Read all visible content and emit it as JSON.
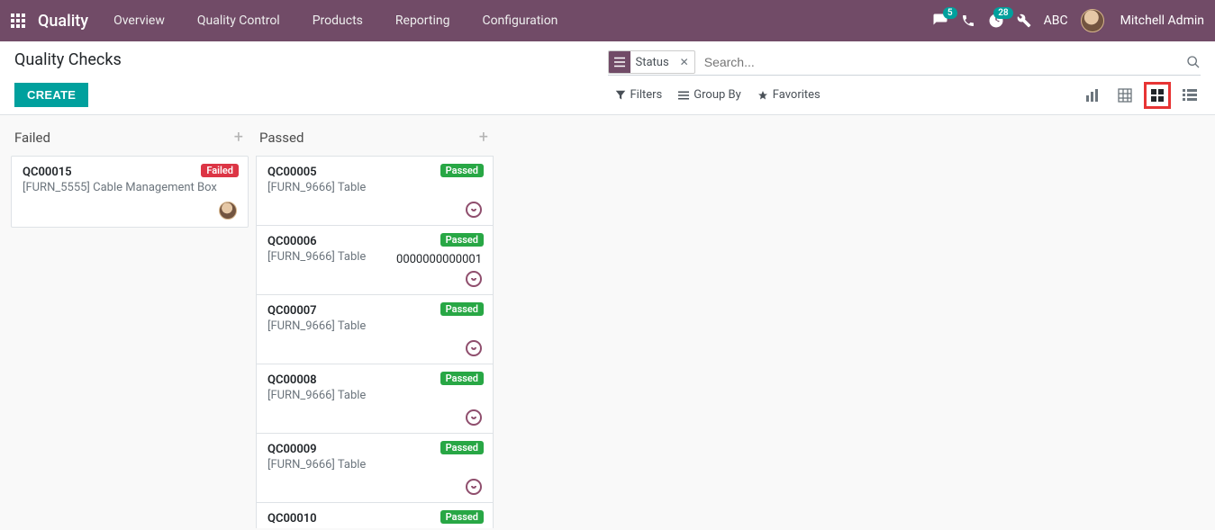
{
  "navbar": {
    "brand": "Quality",
    "items": [
      "Overview",
      "Quality Control",
      "Products",
      "Reporting",
      "Configuration"
    ],
    "messages_badge": "5",
    "activities_badge": "28",
    "tenant": "ABC",
    "user_name": "Mitchell Admin"
  },
  "page": {
    "title": "Quality Checks",
    "create_label": "CREATE"
  },
  "search": {
    "facet_label": "Status",
    "placeholder": "Search...",
    "filters_label": "Filters",
    "groupby_label": "Group By",
    "favorites_label": "Favorites"
  },
  "columns": [
    {
      "title": "Failed",
      "variant": "failed",
      "cards": [
        {
          "code": "QC00015",
          "product": "[FURN_5555] Cable Management Box",
          "status": "Failed",
          "show_avatar": true
        }
      ]
    },
    {
      "title": "Passed",
      "variant": "passed",
      "cards": [
        {
          "code": "QC00005",
          "product": "[FURN_9666] Table",
          "status": "Passed",
          "show_priority": true
        },
        {
          "code": "QC00006",
          "product": "[FURN_9666] Table",
          "status": "Passed",
          "extra": "0000000000001",
          "show_priority": true
        },
        {
          "code": "QC00007",
          "product": "[FURN_9666] Table",
          "status": "Passed",
          "show_priority": true
        },
        {
          "code": "QC00008",
          "product": "[FURN_9666] Table",
          "status": "Passed",
          "show_priority": true
        },
        {
          "code": "QC00009",
          "product": "[FURN_9666] Table",
          "status": "Passed",
          "show_priority": true
        },
        {
          "code": "QC00010",
          "product": "",
          "status": "Passed"
        }
      ]
    }
  ]
}
